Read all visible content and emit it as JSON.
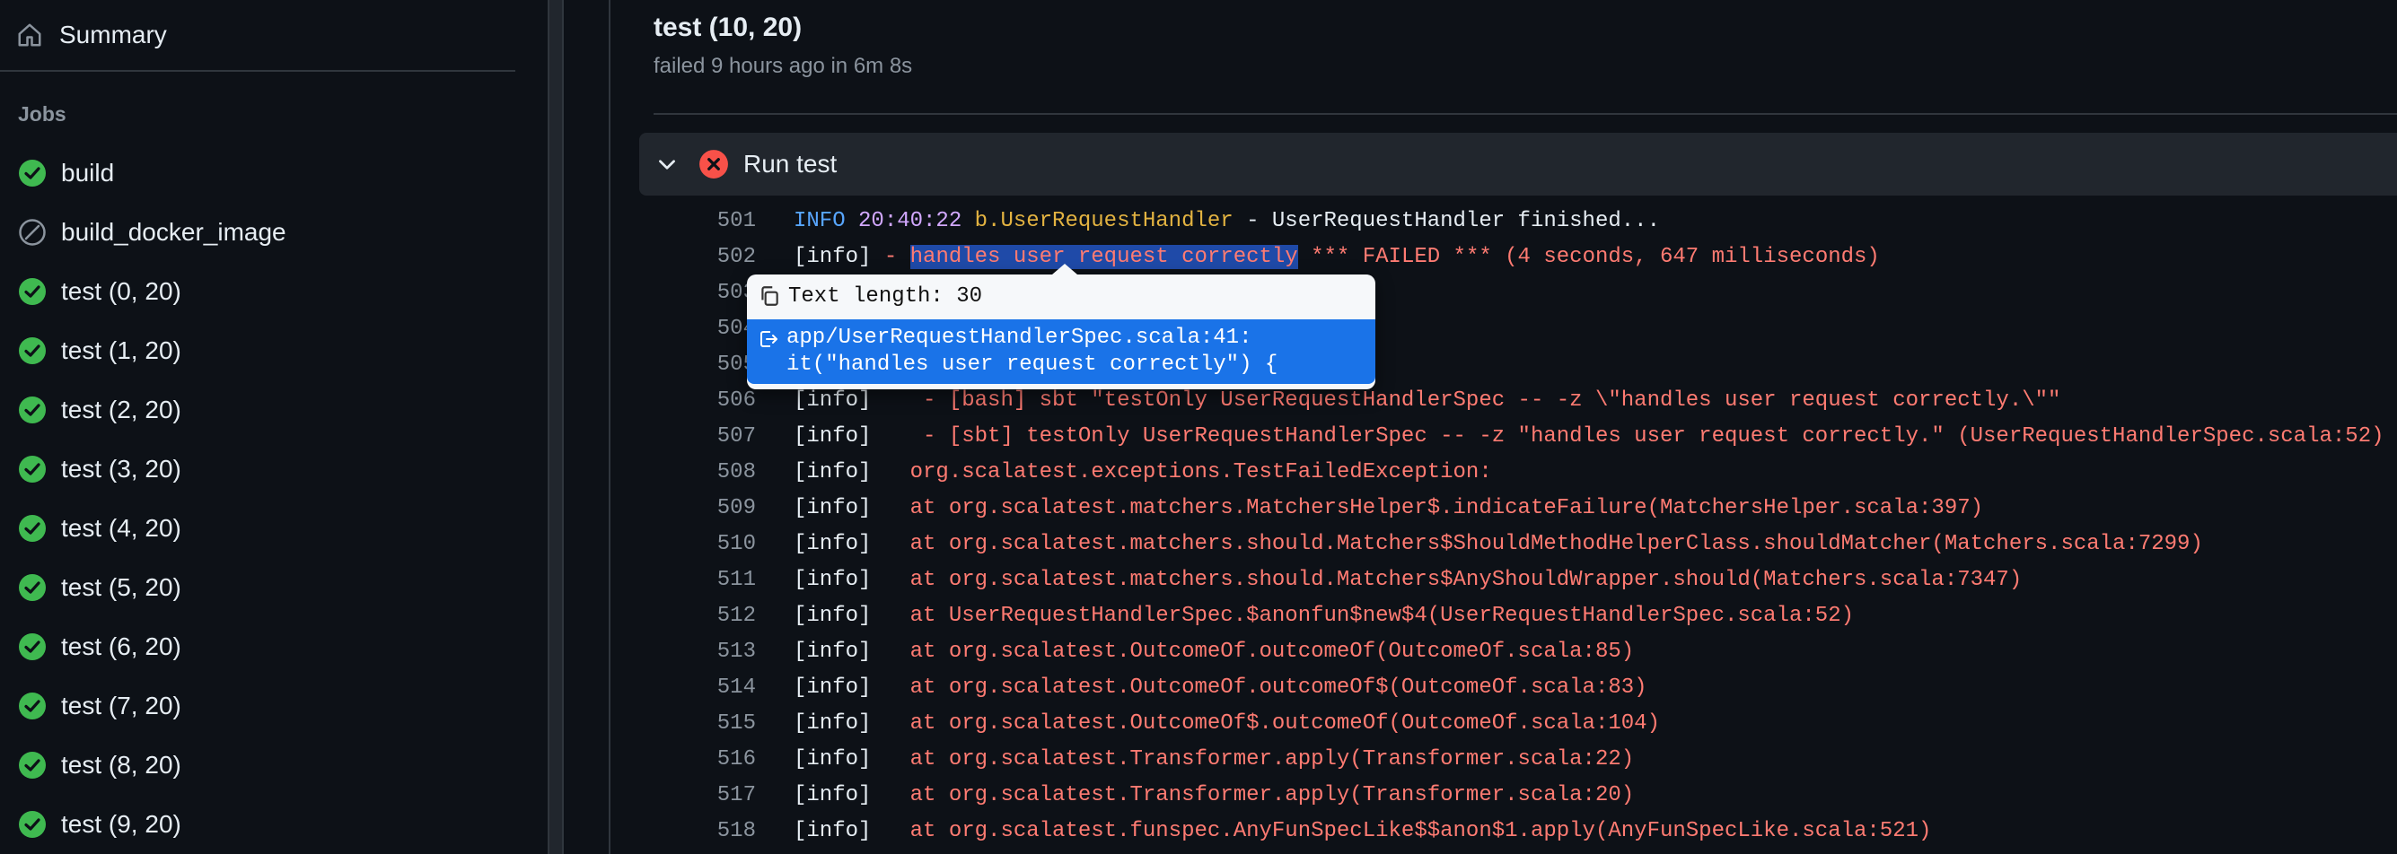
{
  "sidebar": {
    "summary_label": "Summary",
    "jobs_heading": "Jobs",
    "jobs": [
      {
        "label": "build",
        "status": "success"
      },
      {
        "label": "build_docker_image",
        "status": "skipped"
      },
      {
        "label": "test (0, 20)",
        "status": "success"
      },
      {
        "label": "test (1, 20)",
        "status": "success"
      },
      {
        "label": "test (2, 20)",
        "status": "success"
      },
      {
        "label": "test (3, 20)",
        "status": "success"
      },
      {
        "label": "test (4, 20)",
        "status": "success"
      },
      {
        "label": "test (5, 20)",
        "status": "success"
      },
      {
        "label": "test (6, 20)",
        "status": "success"
      },
      {
        "label": "test (7, 20)",
        "status": "success"
      },
      {
        "label": "test (8, 20)",
        "status": "success"
      },
      {
        "label": "test (9, 20)",
        "status": "success"
      }
    ]
  },
  "job": {
    "title": "test (10, 20)",
    "subtitle": "failed 9 hours ago in 6m 8s"
  },
  "step": {
    "name": "Run test",
    "status": "failed"
  },
  "log": {
    "l501": {
      "num": "501",
      "a": "INFO",
      "b": "20:40:22",
      "c": "b.UserRequestHandler",
      "d": " - UserRequestHandler finished..."
    },
    "l502": {
      "num": "502",
      "a": "[info] ",
      "b": "- ",
      "sel": "handles user request correctly",
      "c": " *** FAILED *** (4 seconds, 647 milliseconds)"
    },
    "l503": {
      "num": "503"
    },
    "l504": {
      "num": "504"
    },
    "l505": {
      "num": "505"
    },
    "l506": {
      "num": "506",
      "a": "[info]",
      "b": "    - [bash] sbt \"testOnly UserRequestHandlerSpec -- -z \\\"handles user request correctly.\\\"\""
    },
    "l507": {
      "num": "507",
      "a": "[info]",
      "b": "    - [sbt] testOnly UserRequestHandlerSpec -- -z \"handles user request correctly.\" (UserRequestHandlerSpec.scala:52)"
    },
    "l508": {
      "num": "508",
      "a": "[info]",
      "b": "   org.scalatest.exceptions.TestFailedException:"
    },
    "l509": {
      "num": "509",
      "a": "[info]",
      "b": "   at org.scalatest.matchers.MatchersHelper$.indicateFailure(MatchersHelper.scala:397)"
    },
    "l510": {
      "num": "510",
      "a": "[info]",
      "b": "   at org.scalatest.matchers.should.Matchers$ShouldMethodHelperClass.shouldMatcher(Matchers.scala:7299)"
    },
    "l511": {
      "num": "511",
      "a": "[info]",
      "b": "   at org.scalatest.matchers.should.Matchers$AnyShouldWrapper.should(Matchers.scala:7347)"
    },
    "l512": {
      "num": "512",
      "a": "[info]",
      "b": "   at UserRequestHandlerSpec.$anonfun$new$4(UserRequestHandlerSpec.scala:52)"
    },
    "l513": {
      "num": "513",
      "a": "[info]",
      "b": "   at org.scalatest.OutcomeOf.outcomeOf(OutcomeOf.scala:85)"
    },
    "l514": {
      "num": "514",
      "a": "[info]",
      "b": "   at org.scalatest.OutcomeOf.outcomeOf$(OutcomeOf.scala:83)"
    },
    "l515": {
      "num": "515",
      "a": "[info]",
      "b": "   at org.scalatest.OutcomeOf$.outcomeOf(OutcomeOf.scala:104)"
    },
    "l516": {
      "num": "516",
      "a": "[info]",
      "b": "   at org.scalatest.Transformer.apply(Transformer.scala:22)"
    },
    "l517": {
      "num": "517",
      "a": "[info]",
      "b": "   at org.scalatest.Transformer.apply(Transformer.scala:20)"
    },
    "l518": {
      "num": "518",
      "a": "[info]",
      "b": "   at org.scalatest.funspec.AnyFunSpecLike$$anon$1.apply(AnyFunSpecLike.scala:521)"
    }
  },
  "popup": {
    "length_text": "Text length: 30",
    "link_line1": "app/UserRequestHandlerSpec.scala:41:",
    "link_line2": "it(\"handles user request correctly\") {"
  },
  "colors": {
    "success": "#3fb950",
    "failed": "#f85149",
    "skipped": "#8b949e"
  }
}
